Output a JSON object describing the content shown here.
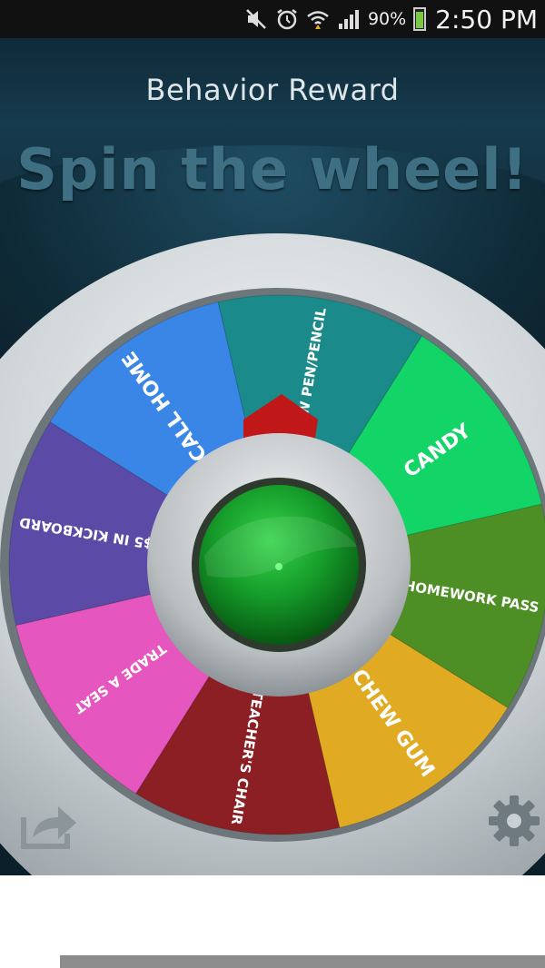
{
  "status_bar": {
    "battery_percent": "90%",
    "time": "2:50 PM",
    "icons": [
      "mute-icon",
      "alarm-icon",
      "wifi-icon",
      "signal-icon",
      "battery-icon"
    ]
  },
  "app": {
    "title": "Behavior Reward",
    "headline": "Spin the wheel!"
  },
  "wheel": {
    "segments": [
      {
        "label": "$5 IN KICKBOARD",
        "color": "#5b4aa6"
      },
      {
        "label": "CALL HOME",
        "color": "#3a86e6"
      },
      {
        "label": "NEW PEN/PENCIL",
        "color": "#1a8a8a"
      },
      {
        "label": "CANDY",
        "color": "#12d467"
      },
      {
        "label": "HOMEWORK PASS",
        "color": "#4e8f25"
      },
      {
        "label": "CHEW GUM",
        "color": "#e0ab23"
      },
      {
        "label": "TEACHER'S CHAIR",
        "color": "#8c1f24"
      },
      {
        "label": "TRADE A SEAT",
        "color": "#e556be"
      }
    ],
    "pointer_color": "#c01818",
    "hub_color": "#1f9a2c"
  },
  "toolbar": {
    "share_icon": "share-icon",
    "settings_icon": "gear-icon"
  }
}
